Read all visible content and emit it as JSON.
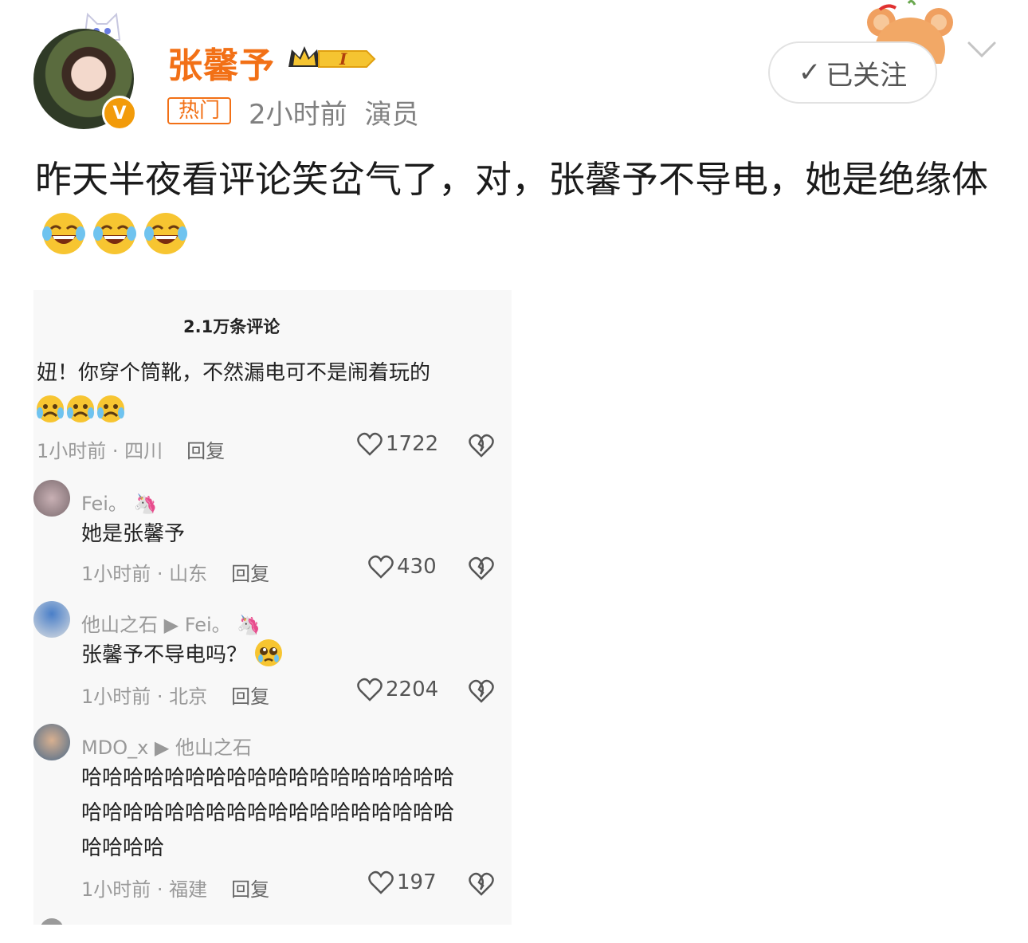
{
  "user": {
    "name": "张馨予",
    "tag": "热门",
    "time": "2小时前",
    "role": "演员",
    "verified_icon": "v-badge-icon",
    "level_badge": "I"
  },
  "follow_button": {
    "label": "已关注"
  },
  "post": {
    "text": "昨天半夜看评论笑岔气了，对，张馨予不导电，她是绝缘体",
    "emojis": [
      "laugh-cry-emoji",
      "laugh-cry-emoji",
      "laugh-cry-emoji"
    ]
  },
  "comments_screenshot": {
    "title": "2.1万条评论",
    "comments": [
      {
        "text": "妞！你穿个筒靴，不然漏电可不是闹着玩的",
        "meta": "1小时前 · 四川",
        "reply": "回复",
        "likes": "1722"
      },
      {
        "user": "Fei。",
        "text": "她是张馨予",
        "meta": "1小时前 · 山东",
        "reply": "回复",
        "likes": "430"
      },
      {
        "user": "他山之石",
        "reply_to": "Fei。",
        "text": "张馨予不导电吗？",
        "meta": "1小时前 · 北京",
        "reply": "回复",
        "likes": "2204"
      },
      {
        "user": "MDO_x",
        "reply_to": "他山之石",
        "text_lines": [
          "哈哈哈哈哈哈哈哈哈哈哈哈哈哈哈哈哈哈",
          "哈哈哈哈哈哈哈哈哈哈哈哈哈哈哈哈哈哈",
          "哈哈哈哈"
        ],
        "meta": "1小时前 · 福建",
        "reply": "回复",
        "likes": "197"
      }
    ]
  },
  "colors": {
    "accent": "#f27016",
    "meta_gray": "#808080",
    "comment_bg": "#f8f8f8"
  }
}
